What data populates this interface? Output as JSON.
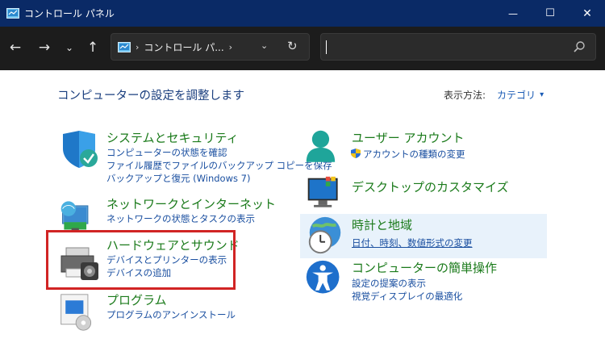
{
  "window": {
    "title": "コントロール パネル",
    "min_glyph": "—",
    "max_glyph": "☐",
    "close_glyph": "✕"
  },
  "nav": {
    "back": "←",
    "forward": "→",
    "recent": "⌄",
    "up": "↑",
    "breadcrumb_sep": "›",
    "breadcrumb": "コントロール パ...",
    "breadcrumb_sep2": "›",
    "dropdown": "⌄",
    "refresh": "↻",
    "search_value": ""
  },
  "content": {
    "page_title": "コンピューターの設定を調整します",
    "view_by_label": "表示方法:",
    "view_by_value": "カテゴリ",
    "view_by_arrow": "▾"
  },
  "categories_left": [
    {
      "title": "システムとセキュリティ",
      "links": [
        "コンピューターの状態を確認",
        "ファイル履歴でファイルのバックアップ コピーを保存",
        "バックアップと復元 (Windows 7)"
      ],
      "icon": "shield-icon"
    },
    {
      "title": "ネットワークとインターネット",
      "links": [
        "ネットワークの状態とタスクの表示"
      ],
      "icon": "network-icon"
    },
    {
      "title": "ハードウェアとサウンド",
      "links": [
        "デバイスとプリンターの表示",
        "デバイスの追加"
      ],
      "icon": "printer-icon"
    },
    {
      "title": "プログラム",
      "links": [
        "プログラムのアンインストール"
      ],
      "icon": "programs-icon"
    }
  ],
  "categories_right": [
    {
      "title": "ユーザー アカウント",
      "links": [
        "アカウントの種類の変更"
      ],
      "icon": "user-icon"
    },
    {
      "title": "デスクトップのカスタマイズ",
      "links": [],
      "icon": "desktop-icon"
    },
    {
      "title": "時計と地域",
      "links": [
        "日付、時刻、数値形式の変更"
      ],
      "icon": "clock-globe-icon"
    },
    {
      "title": "コンピューターの簡単操作",
      "links": [
        "設定の提案の表示",
        "視覚ディスプレイの最適化"
      ],
      "icon": "accessibility-icon"
    }
  ],
  "colors": {
    "titlebar": "#0a2a66",
    "navbar": "#1c1c1c",
    "category_title": "#1a7a1a",
    "link": "#1a4fa0",
    "highlight": "#e8f2fb",
    "annotation_box": "#d12424"
  }
}
